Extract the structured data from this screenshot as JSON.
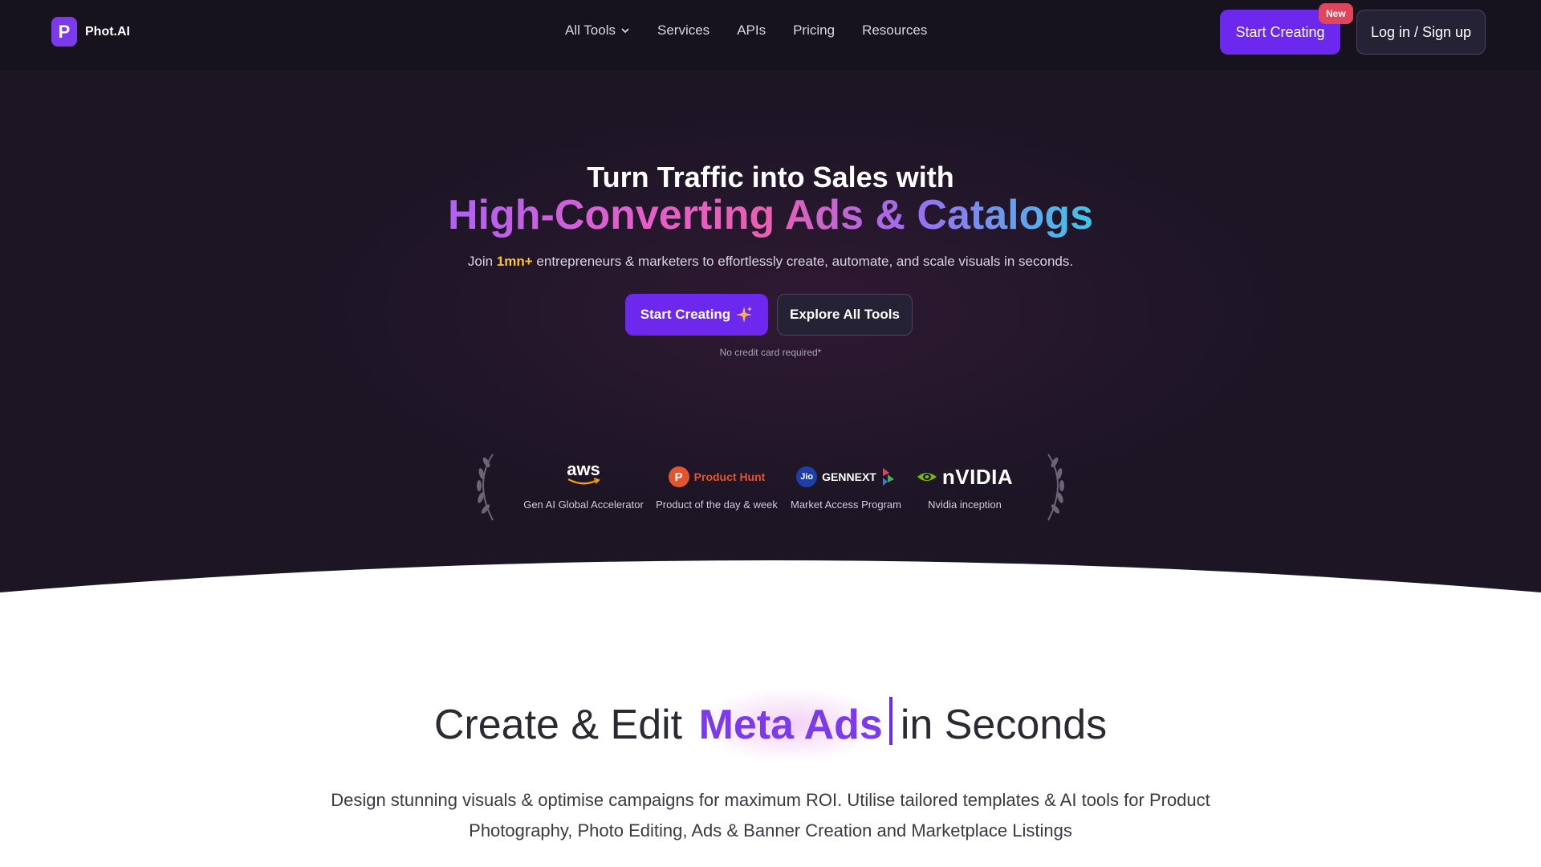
{
  "header": {
    "logo_letter": "P",
    "logo_text": "Phot.AI",
    "nav": [
      {
        "label": "All Tools",
        "has_dropdown": true
      },
      {
        "label": "Services"
      },
      {
        "label": "APIs"
      },
      {
        "label": "Pricing"
      },
      {
        "label": "Resources"
      }
    ],
    "start_creating_label": "Start Creating",
    "new_badge": "New",
    "login_label": "Log in / Sign up"
  },
  "hero": {
    "title_line1": "Turn Traffic into Sales with",
    "title_line2": "High-Converting Ads & Catalogs",
    "subtitle_pre": "Join ",
    "subtitle_highlight": "1mn+",
    "subtitle_post": " entrepreneurs & marketers to effortlessly create, automate, and scale visuals in seconds.",
    "primary_cta": "Start Creating",
    "secondary_cta": "Explore All Tools",
    "note": "No credit card required*"
  },
  "partners": [
    {
      "logo_text": "aws",
      "caption": "Gen AI Global Accelerator"
    },
    {
      "logo_letter": "P",
      "logo_text": "Product Hunt",
      "caption": "Product of the day & week"
    },
    {
      "logo_letter": "Jio",
      "logo_text": "GENNEXT",
      "caption": "Market Access Program"
    },
    {
      "logo_text": "nVIDIA",
      "caption": "Nvidia inception"
    }
  ],
  "section": {
    "title_pre": "Create & Edit ",
    "title_accent": "Meta Ads",
    "title_post": "in Seconds",
    "description": "Design stunning visuals & optimise campaigns for maximum ROI. Utilise tailored templates & AI tools for Product Photography, Photo Editing, Ads & Banner Creation and Marketplace Listings"
  },
  "colors": {
    "primary": "#6d28ed",
    "hero_bg": "#1b1524",
    "badge": "#e0455a",
    "highlight": "#f6c33d"
  }
}
